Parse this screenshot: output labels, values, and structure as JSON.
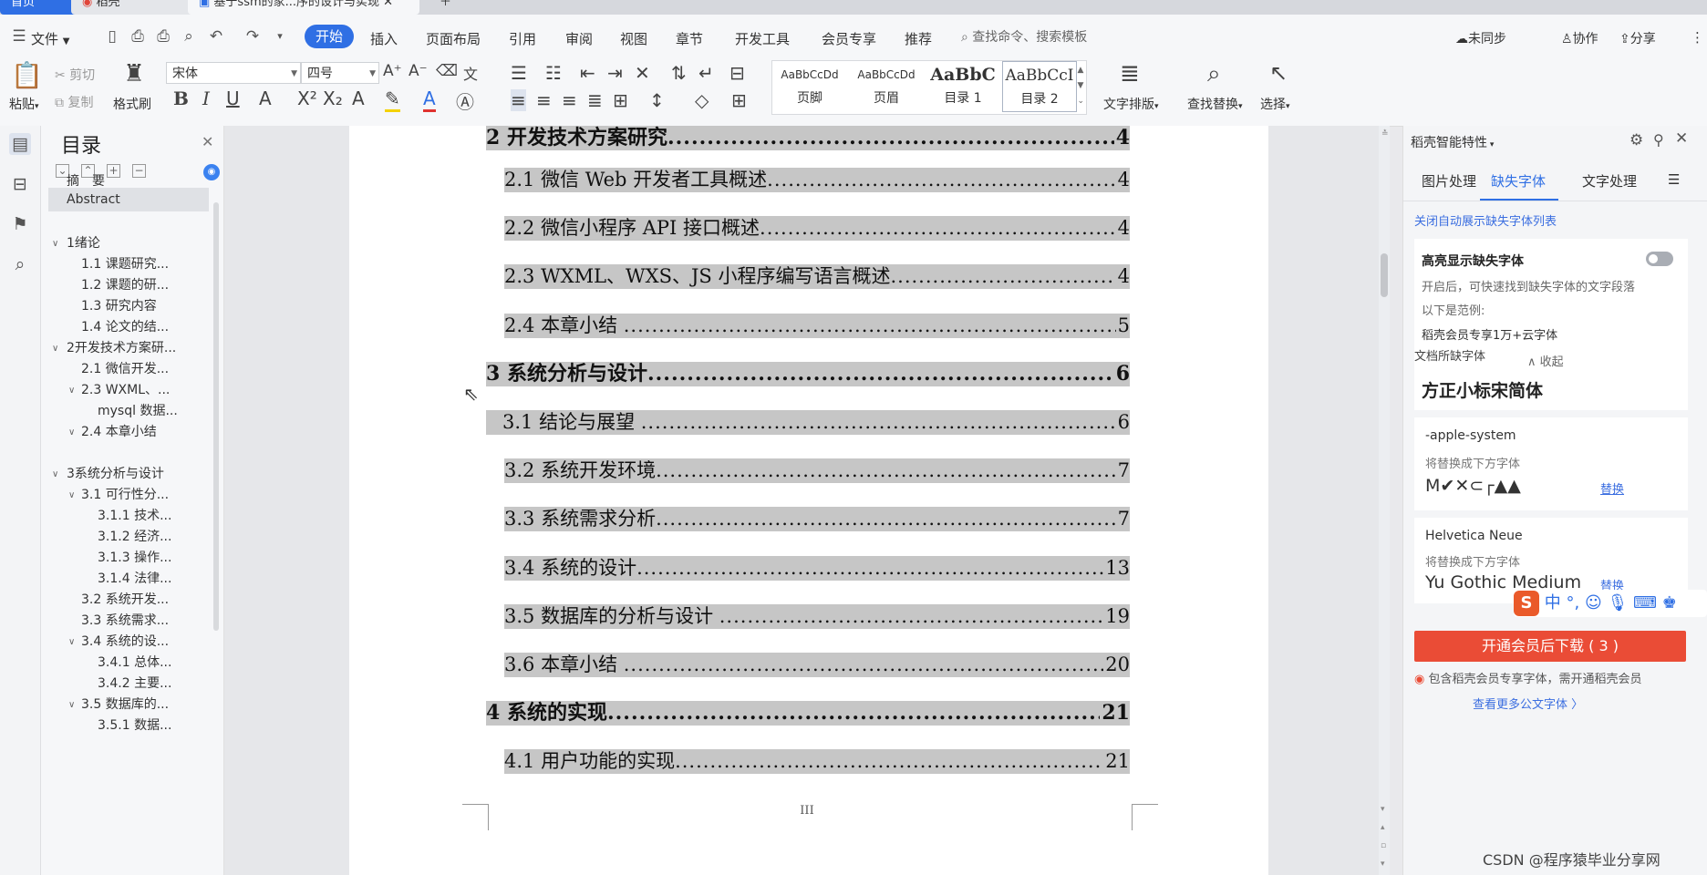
{
  "tabs": [
    {
      "label": "首页"
    },
    {
      "label": "稻壳"
    },
    {
      "label": "基于ssm的家...序的设计与实现"
    }
  ],
  "menu": {
    "file": "文件",
    "items": [
      "开始",
      "插入",
      "页面布局",
      "引用",
      "审阅",
      "视图",
      "章节",
      "开发工具",
      "会员专享",
      "推荐"
    ],
    "active": "开始",
    "search_placeholder": "查找命令、搜索模板",
    "right": [
      "未同步",
      "协作",
      "分享"
    ]
  },
  "ribbon": {
    "paste": "粘贴",
    "cut": "剪切",
    "copy": "复制",
    "format_painter": "格式刷",
    "font_name": "宋体",
    "font_size": "四号",
    "styles": [
      {
        "sample": "AaBbCcDd",
        "name": "页脚"
      },
      {
        "sample": "AaBbCcDd",
        "name": "页眉"
      },
      {
        "sample": "AaBbC",
        "name": "目录 1"
      },
      {
        "sample": "AaBbCcI",
        "name": "目录 2"
      }
    ],
    "text_layout": "文字排版",
    "find_replace": "查找替换",
    "select": "选择"
  },
  "toc_pane": {
    "title": "目录",
    "items": [
      {
        "label": "摘　要",
        "level": "top"
      },
      {
        "label": "Abstract",
        "level": "top",
        "selected": true
      },
      {
        "label": "1绪论",
        "level": 1,
        "expanded": true
      },
      {
        "label": "1.1  课题研究...",
        "level": 2
      },
      {
        "label": "1.2  课题的研...",
        "level": 2
      },
      {
        "label": "1.3  研究内容",
        "level": 2
      },
      {
        "label": "1.4  论文的结...",
        "level": 2
      },
      {
        "label": "2开发技术方案研...",
        "level": 1,
        "expanded": true
      },
      {
        "label": "2.1  微信开发...",
        "level": 2
      },
      {
        "label": "2.3  WXML、...",
        "level": 2,
        "expanded": true
      },
      {
        "label": "mysql 数据...",
        "level": 3
      },
      {
        "label": "2.4  本章小结",
        "level": 2,
        "expanded": true
      },
      {
        "label": "3系统分析与设计",
        "level": 1,
        "expanded": true
      },
      {
        "label": "3.1  可行性分...",
        "level": 2,
        "expanded": true
      },
      {
        "label": "3.1.1  技术...",
        "level": 3
      },
      {
        "label": "3.1.2  经济...",
        "level": 3
      },
      {
        "label": "3.1.3  操作...",
        "level": 3
      },
      {
        "label": "3.1.4  法律...",
        "level": 3
      },
      {
        "label": "3.2  系统开发...",
        "level": 2
      },
      {
        "label": "3.3  系统需求...",
        "level": 2
      },
      {
        "label": "3.4  系统的设...",
        "level": 2,
        "expanded": true
      },
      {
        "label": "3.4.1  总体...",
        "level": 3
      },
      {
        "label": "3.4.2  主要...",
        "level": 3
      },
      {
        "label": "3.5  数据库的...",
        "level": 2,
        "expanded": true
      },
      {
        "label": "3.5.1  数据...",
        "level": 3
      }
    ]
  },
  "document": {
    "lines": [
      {
        "text": "2  开发技术方案研究",
        "page": "4",
        "level": 1
      },
      {
        "text": "2.1  微信 Web 开发者工具概述",
        "page": "4",
        "level": 2
      },
      {
        "text": "2.2  微信小程序 API 接口概述",
        "page": "4",
        "level": 2
      },
      {
        "text": "2.3  WXML、WXS、JS 小程序编写语言概述",
        "page": "4",
        "level": 2
      },
      {
        "text": "2.4 本章小结 ",
        "page": "5",
        "level": 2
      },
      {
        "text": "3  系统分析与设计",
        "page": "6",
        "level": 1
      },
      {
        "text": "3.1 结论与展望 ",
        "page": "6",
        "level": 2
      },
      {
        "text": "3.2 系统开发环境",
        "page": "7",
        "level": 2
      },
      {
        "text": "3.3 系统需求分析",
        "page": "7",
        "level": 2
      },
      {
        "text": "3.4 系统的设计",
        "page": "13",
        "level": 2
      },
      {
        "text": "3.5 数据库的分析与设计 ",
        "page": "19",
        "level": 2
      },
      {
        "text": "3.6 本章小结 ",
        "page": "20",
        "level": 2
      },
      {
        "text": "4  系统的实现",
        "page": "21",
        "level": 1
      },
      {
        "text": "4.1  用户功能的实现",
        "page": "21",
        "level": 2
      }
    ],
    "page_number": "III"
  },
  "right_panel": {
    "header": "稻壳智能特性",
    "tabs": [
      "图片处理",
      "缺失字体",
      "文字处理"
    ],
    "active_tab": "缺失字体",
    "auto_list_link": "关闭自动展示缺失字体列表",
    "highlight_title": "高亮显示缺失字体",
    "highlight_desc": "开启后，可快速找到缺失字体的文字段落",
    "example_label": "以下是范例:",
    "example_text": "稻壳会员专享1万+云字体",
    "collapse": "收起",
    "missing_title": "文档所缺字体",
    "fonts": [
      {
        "name": "方正小标宋简体"
      },
      {
        "name": "-apple-system",
        "hint": "将替换成下方字体",
        "replacement": "M✔✕⊂┌▲▲",
        "action": "替换"
      },
      {
        "name": "Helvetica Neue",
        "hint": "将替换成下方字体",
        "replacement": "Yu Gothic Medium",
        "action": "替换"
      }
    ],
    "download_button": "开通会员后下载 ( 3 )",
    "member_note": "包含稻壳会员专享字体，需开通稻壳会员",
    "more_link": "查看更多公文字体 〉"
  },
  "watermark": "CSDN @程序猿毕业分享网",
  "colors": {
    "accent": "#2f6fe4",
    "download": "#ea4c36",
    "highlight": "#c6c6c6"
  }
}
